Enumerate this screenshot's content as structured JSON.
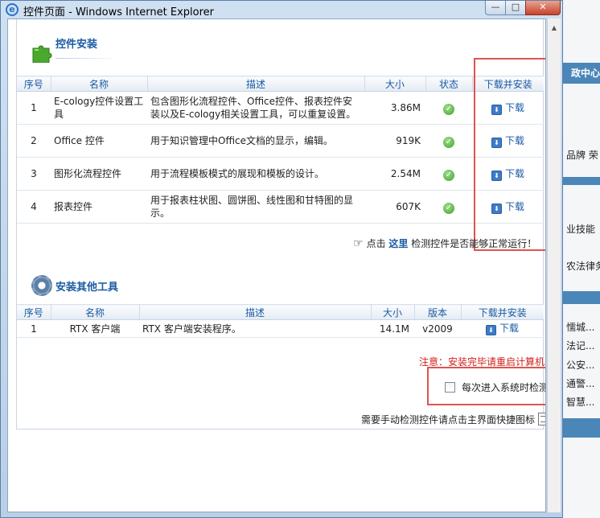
{
  "window": {
    "title": "控件页面 - Windows Internet Explorer",
    "min_glyph": "—",
    "max_glyph": "□",
    "close_glyph": "✕"
  },
  "section1": {
    "title": "控件安装",
    "headers": [
      "序号",
      "名称",
      "描述",
      "大小",
      "状态",
      "下载并安装"
    ],
    "rows": [
      {
        "no": "1",
        "name": "E-cology控件设置工具",
        "desc": "包含图形化流程控件、Office控件、报表控件安装以及E-cology相关设置工具，可以重复设置。",
        "size": "3.86M",
        "status": "ok",
        "download": "下载"
      },
      {
        "no": "2",
        "name": "Office 控件",
        "desc": "用于知识管理中Office文档的显示，编辑。",
        "size": "919K",
        "status": "ok",
        "download": "下载"
      },
      {
        "no": "3",
        "name": "图形化流程控件",
        "desc": "用于流程模板模式的展现和模板的设计。",
        "size": "2.54M",
        "status": "ok",
        "download": "下载"
      },
      {
        "no": "4",
        "name": "报表控件",
        "desc": "用于报表柱状图、圆饼图、线性图和甘特图的显示。",
        "size": "607K",
        "status": "ok",
        "download": "下载"
      }
    ],
    "hint_prefix": "点击",
    "hint_link": "这里",
    "hint_suffix": "检测控件是否能够正常运行！"
  },
  "section2": {
    "title": "安装其他工具",
    "headers": [
      "序号",
      "名称",
      "描述",
      "大小",
      "版本",
      "下载并安装"
    ],
    "rows": [
      {
        "no": "1",
        "name": "RTX 客户端",
        "desc": "RTX 客户端安装程序。",
        "size": "14.1M",
        "version": "v2009",
        "download": "下载"
      }
    ]
  },
  "footer": {
    "warning": "注意：安装完毕请重启计算机！",
    "checkbox_label": "每次进入系统时检测",
    "checkbox_checked": false,
    "manual_text": "需要手动检测控件请点击主界面快捷图标"
  },
  "background_app": {
    "header": "政中心",
    "lines": [
      "品牌 荣",
      "业技能",
      "农法律务",
      "懦城...",
      "法记...",
      "公安...",
      "通警...",
      "智慧..."
    ]
  },
  "colors": {
    "accent": "#1b5aa3",
    "warning": "#d1201a",
    "highlight_box": "#e0534f",
    "status_ok": "#3ea12b"
  }
}
